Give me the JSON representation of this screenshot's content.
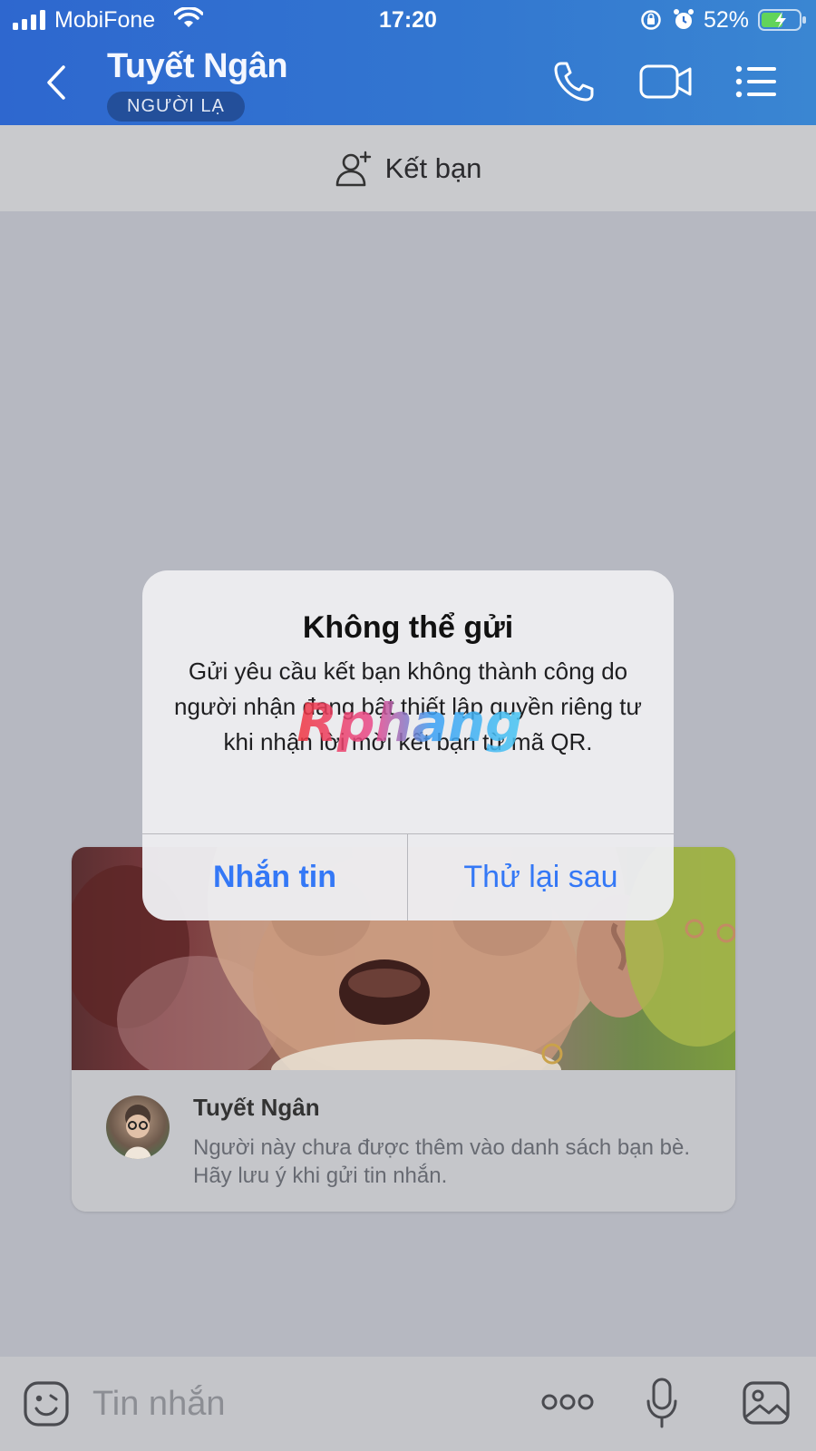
{
  "status_bar": {
    "carrier": "MobiFone",
    "time": "17:20",
    "battery": "52%"
  },
  "header": {
    "title": "Tuyết Ngân",
    "badge": "NGƯỜI LẠ",
    "icons": [
      "back-icon",
      "phone-icon",
      "video-camera-icon",
      "menu-list-icon"
    ]
  },
  "friend_bar": {
    "label": "Kết bạn",
    "icon": "add-friend-icon"
  },
  "profile_card": {
    "name": "Tuyết Ngân",
    "description": "Người này chưa được thêm vào danh sách bạn bè. Hãy lưu ý khi gửi tin nhắn."
  },
  "dialog": {
    "title": "Không thể gửi",
    "message": "Gửi yêu cầu kết bạn không thành công do người nhận đang bật thiết lập quyền riêng tư khi nhận lời mời kết bạn từ mã QR.",
    "primary_button": "Nhắn tin",
    "secondary_button": "Thử lại sau",
    "watermark": "Rphang"
  },
  "input_bar": {
    "placeholder": "Tin nhắn",
    "icons": [
      "emoji-icon",
      "more-icon",
      "microphone-icon",
      "image-icon"
    ]
  },
  "colors": {
    "header_blue": "#2e67cf",
    "accent_blue": "#3478f6",
    "backdrop": "#b6b8c1"
  }
}
